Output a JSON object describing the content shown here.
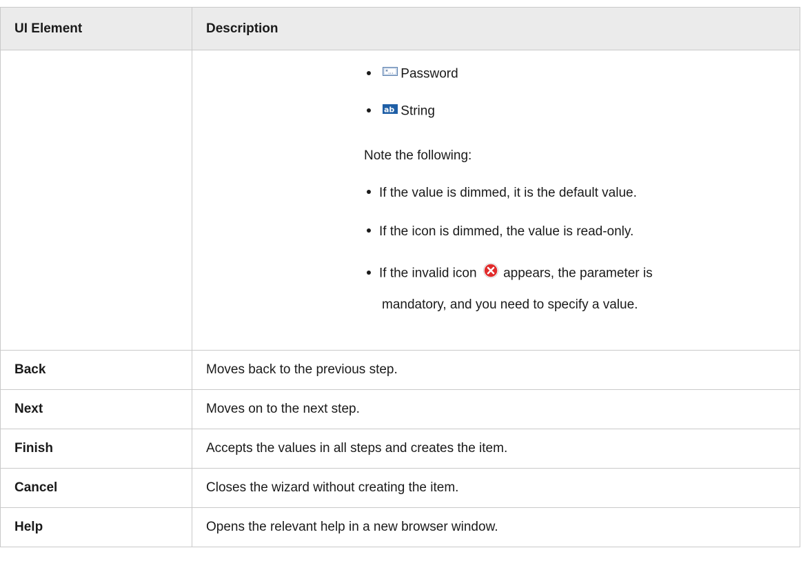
{
  "table": {
    "headers": {
      "element": "UI Element",
      "description": "Description"
    },
    "value_types": [
      {
        "icon": "password-icon",
        "label": "Password"
      },
      {
        "icon": "string-icon",
        "label": "String"
      }
    ],
    "note_intro": "Note the following:",
    "notes": [
      "If the value is dimmed, it is the default value.",
      "If the icon is dimmed, the value is read-only."
    ],
    "invalid_note": {
      "before": "If the invalid icon",
      "after": "appears, the parameter is",
      "line2": "mandatory, and you need to specify a value."
    },
    "rows": [
      {
        "element": "Back",
        "description": "Moves back to the previous step."
      },
      {
        "element": "Next",
        "description": "Moves on to the next step."
      },
      {
        "element": "Finish",
        "description": "Accepts the values in all steps and creates the item."
      },
      {
        "element": "Cancel",
        "description": "Closes the wizard without creating the item."
      },
      {
        "element": "Help",
        "description": "Opens the relevant help in a new browser window."
      }
    ]
  }
}
